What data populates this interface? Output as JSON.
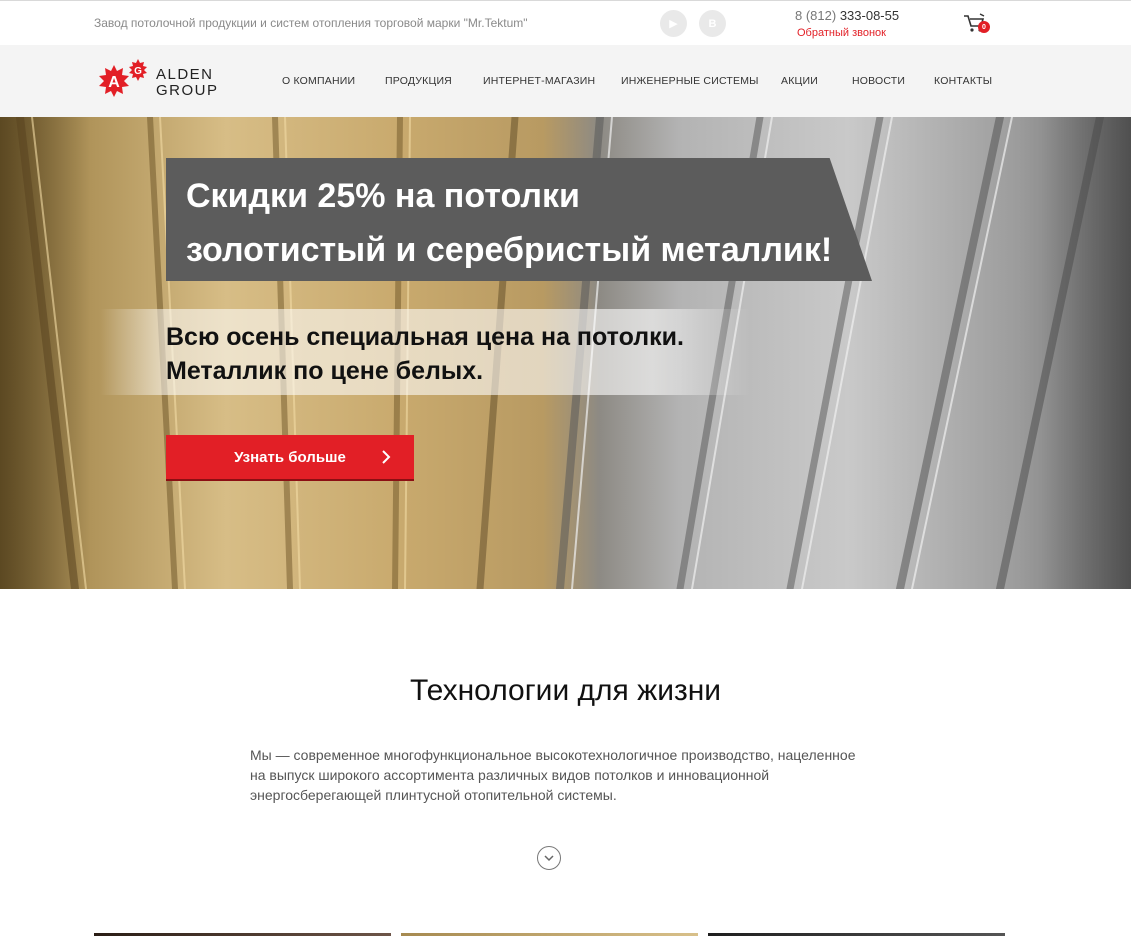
{
  "topbar": {
    "tagline": "Завод потолочной продукции и систем отопления торговой марки \"Mr.Tektum\"",
    "social": [
      {
        "icon": "youtube-play-icon",
        "label": "▶"
      },
      {
        "icon": "vk-icon",
        "label": "B"
      }
    ],
    "phone_prefix": "8 (812)",
    "phone_number": "333-08-55",
    "callback_label": "Обратный звонок",
    "cart_count": "0"
  },
  "header": {
    "logo_letters": [
      "A",
      "G"
    ],
    "logo_line1": "ALDEN",
    "logo_line2": "GROUP",
    "nav": [
      "О КОМПАНИИ",
      "ПРОДУКЦИЯ",
      "ИНТЕРНЕТ-МАГАЗИН",
      "ИНЖЕНЕРНЫЕ СИСТЕМЫ",
      "АКЦИИ",
      "НОВОСТИ",
      "КОНТАКТЫ"
    ]
  },
  "hero": {
    "headline_line1": "Скидки 25% на потолки",
    "headline_line2": "золотистый и серебристый металлик!",
    "sub_line1": "Всю осень специальная цена на потолки.",
    "sub_line2": "Металлик по цене белых.",
    "cta_label": "Узнать больше"
  },
  "about": {
    "title": "Технологии для жизни",
    "text": "Мы — современное многофункциональное высокотехнологичное производство, нацеленное на выпуск широкого ассортимента различных видов потолков и инновационной энергосберегающей плинтусной отопительной системы."
  },
  "colors": {
    "accent": "#e21f26",
    "nav_bg": "#f4f4f4",
    "banner_bg": "#5c5c5c"
  }
}
